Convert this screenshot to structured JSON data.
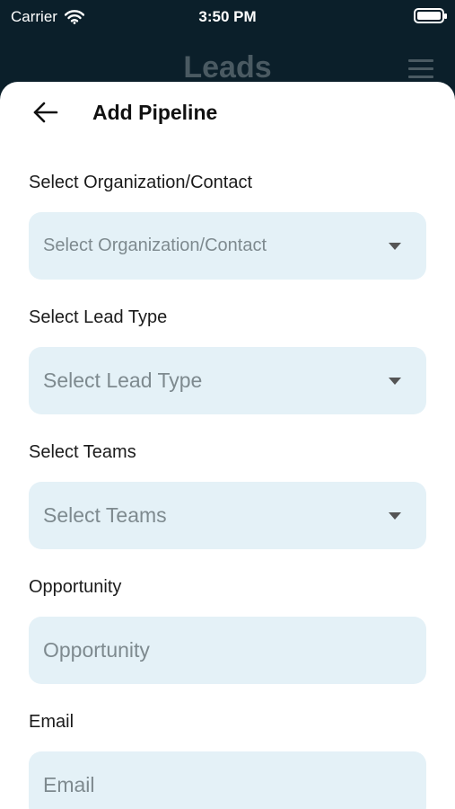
{
  "status_bar": {
    "carrier": "Carrier",
    "time": "3:50 PM"
  },
  "background": {
    "title": "Leads"
  },
  "sheet": {
    "title": "Add Pipeline"
  },
  "fields": [
    {
      "label": "Select Organization/Contact",
      "placeholder": "Select Organization/Contact",
      "type": "dropdown"
    },
    {
      "label": "Select Lead Type",
      "placeholder": "Select Lead Type",
      "type": "dropdown"
    },
    {
      "label": "Select Teams",
      "placeholder": "Select Teams",
      "type": "dropdown"
    },
    {
      "label": "Opportunity",
      "placeholder": "Opportunity",
      "type": "text"
    },
    {
      "label": "Email",
      "placeholder": "Email",
      "type": "text"
    }
  ],
  "colors": {
    "field_bg": "#e4f1f7",
    "header_bg": "#0b1f2a"
  }
}
